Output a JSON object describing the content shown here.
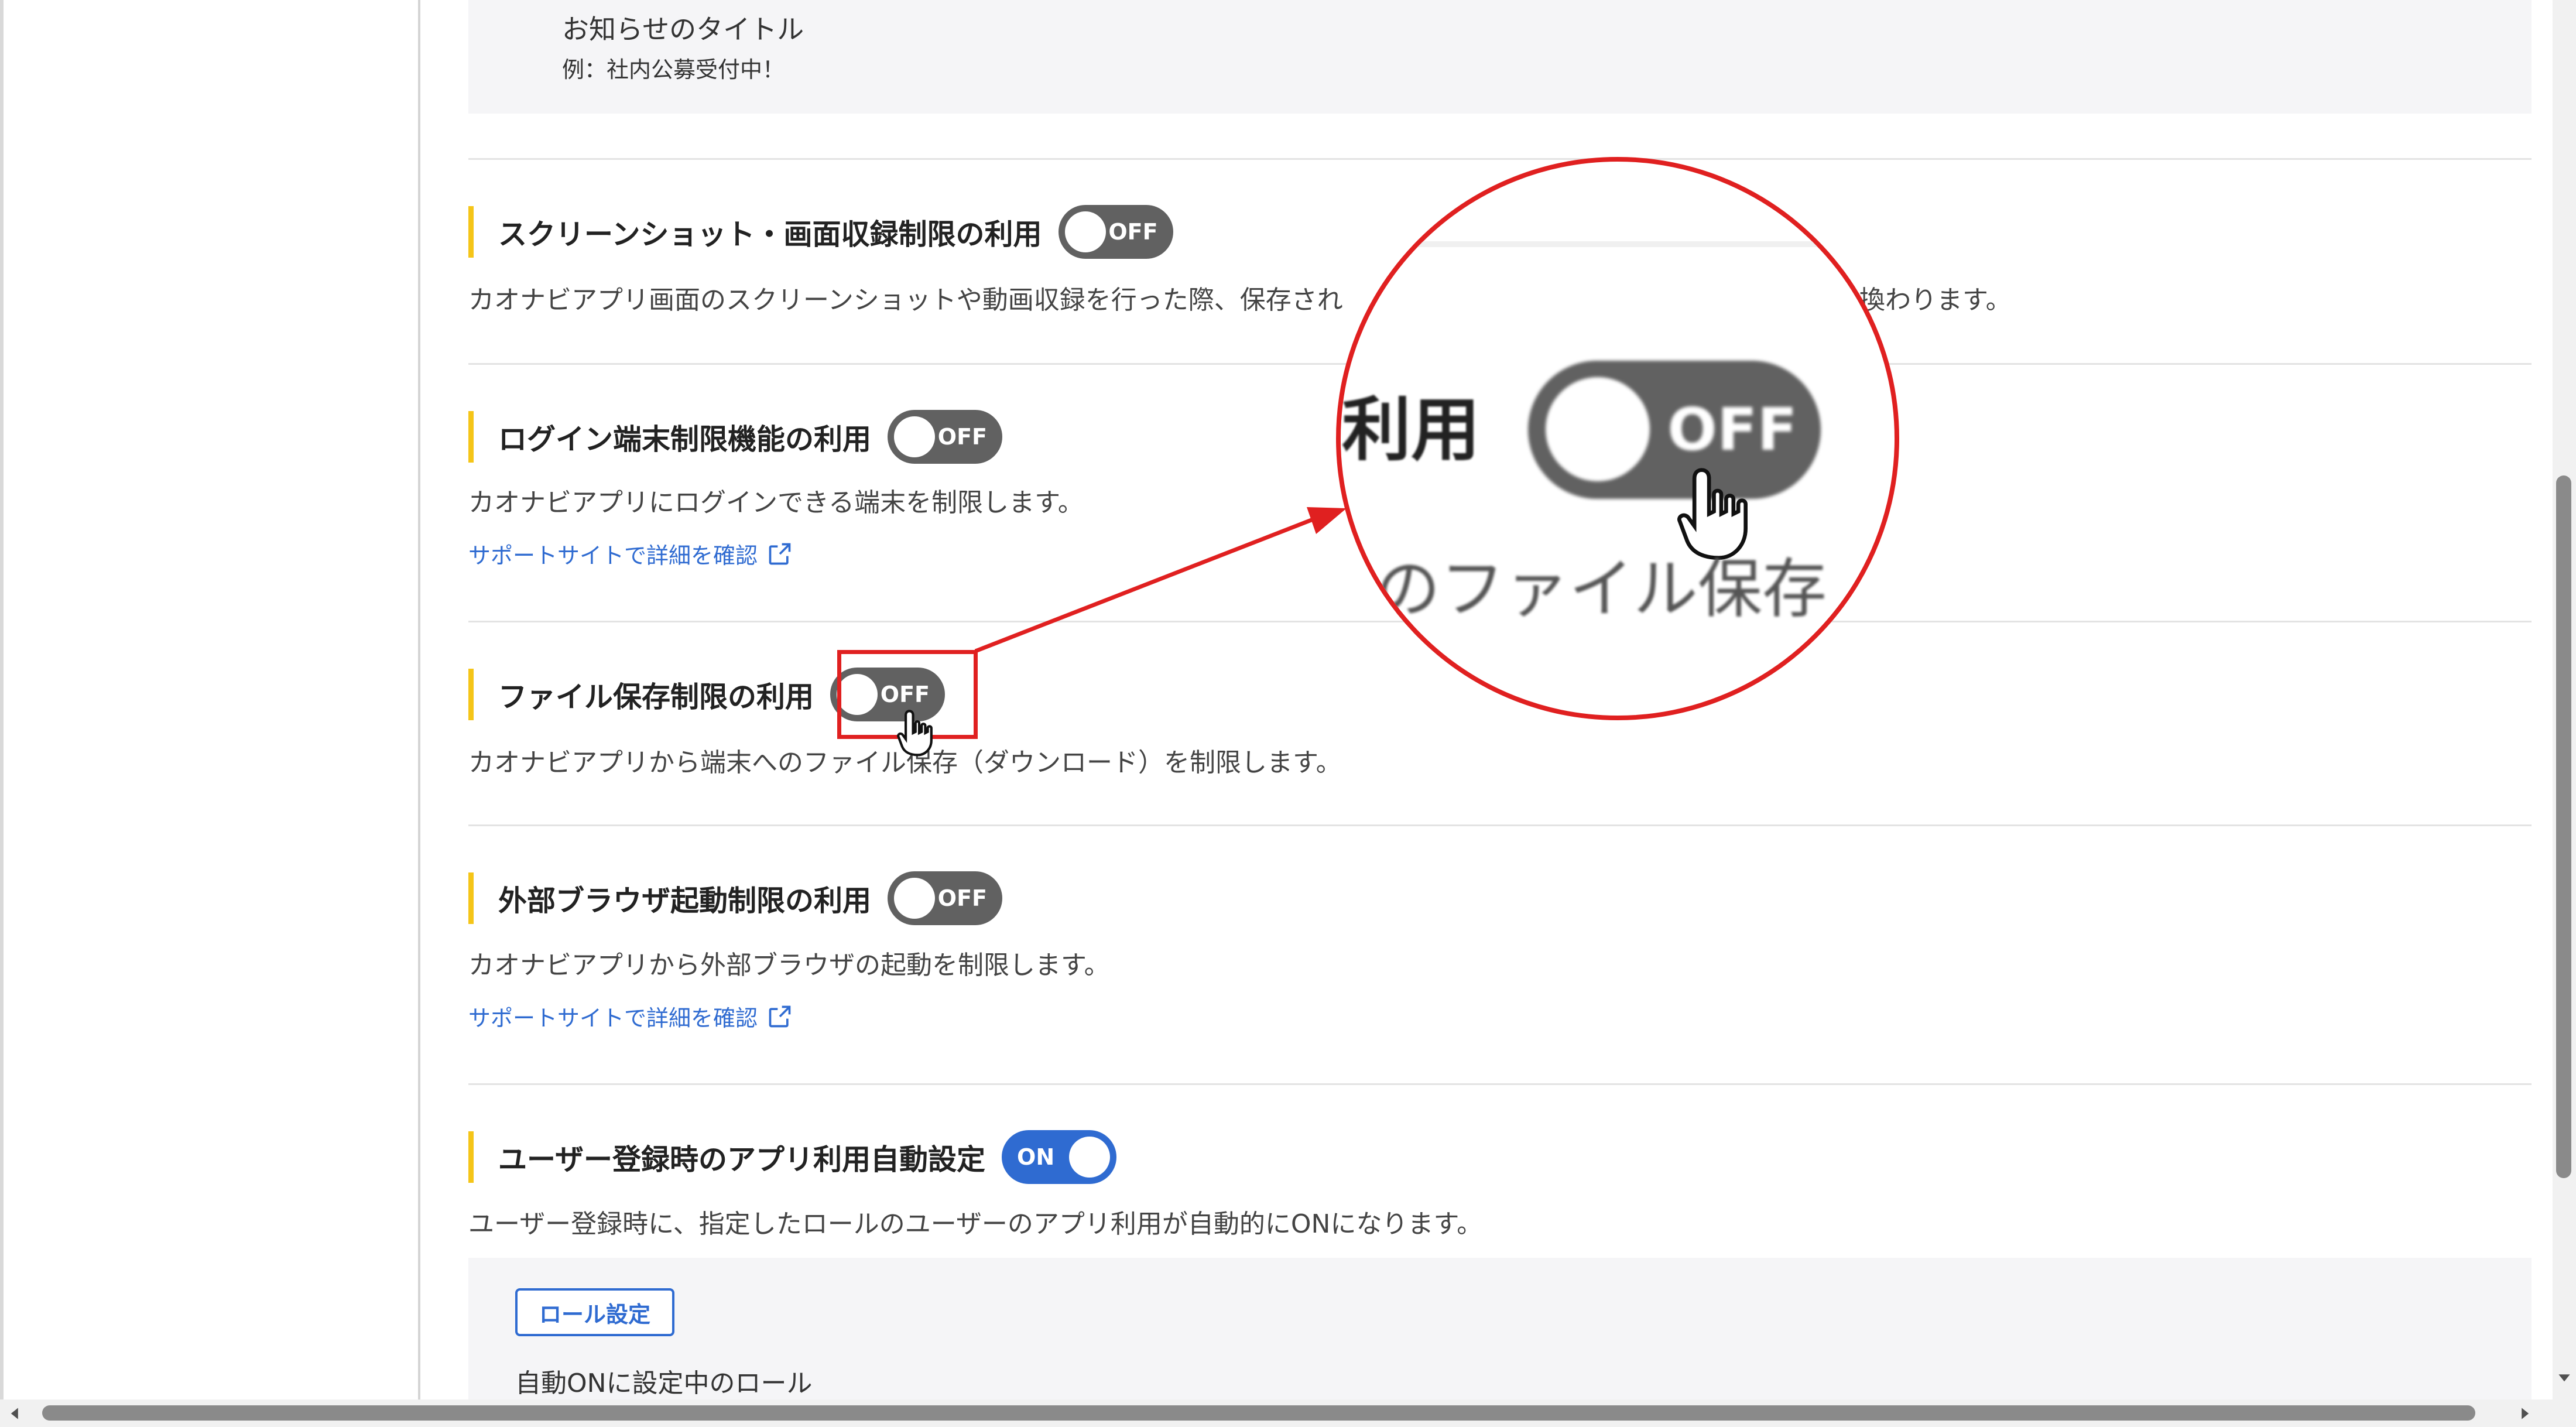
{
  "notice": {
    "title": "お知らせのタイトル",
    "example": "例：社内公募受付中！"
  },
  "sections": {
    "screenshot": {
      "title": "スクリーンショット・画面収録制限の利用",
      "toggle": "OFF",
      "description": "カオナビアプリ画面のスクリーンショットや動画収録を行った際、保存され",
      "description_tail": "換わります。"
    },
    "login": {
      "title": "ログイン端末制限機能の利用",
      "toggle": "OFF",
      "description": "カオナビアプリにログインできる端末を制限します。",
      "link": "サポートサイトで詳細を確認"
    },
    "file": {
      "title": "ファイル保存制限の利用",
      "toggle": "OFF",
      "description": "カオナビアプリから端末へのファイル保存（ダウンロード）を制限します。"
    },
    "browser": {
      "title": "外部ブラウザ起動制限の利用",
      "toggle": "OFF",
      "description": "カオナビアプリから外部ブラウザの起動を制限します。",
      "link": "サポートサイトで詳細を確認"
    },
    "auto": {
      "title": "ユーザー登録時のアプリ利用自動設定",
      "toggle": "ON",
      "description": "ユーザー登録時に、指定したロールのユーザーのアプリ利用が自動的にONになります。",
      "role_button": "ロール設定",
      "role_label": "自動ONに設定中のロール"
    }
  },
  "zoom": {
    "text_top": "利用",
    "toggle": "OFF",
    "text_bottom": "のファイル保存"
  },
  "colors": {
    "toggle_off": "#616161",
    "toggle_on": "#2f6bd1",
    "accent_bar": "#f5c518",
    "highlight": "#e02020",
    "link": "#2f6bd1"
  },
  "icons": [
    "external-link-icon",
    "hand-cursor-icon",
    "scroll-arrow-icon"
  ]
}
